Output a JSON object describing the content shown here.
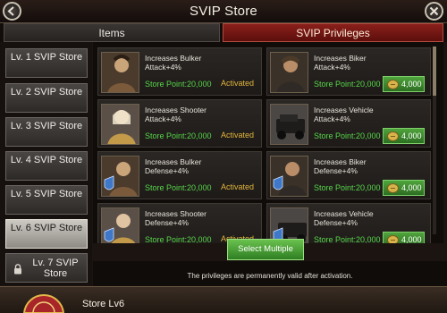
{
  "window": {
    "title": "SVIP Store"
  },
  "tabs": {
    "items": "Items",
    "privileges": "SVIP Privileges"
  },
  "sidebar": {
    "levels": [
      {
        "label": "Lv. 1 SVIP Store"
      },
      {
        "label": "Lv. 2 SVIP Store"
      },
      {
        "label": "Lv. 3 SVIP Store"
      },
      {
        "label": "Lv. 4 SVIP Store"
      },
      {
        "label": "Lv. 5 SVIP Store"
      },
      {
        "label": "Lv. 6 SVIP Store",
        "active": true
      },
      {
        "label": "Lv. 7 SVIP Store",
        "locked": true
      }
    ]
  },
  "privileges": [
    {
      "title": "Increases Bulker Attack+4%",
      "points": "Store Point:20,000",
      "status": "Activated"
    },
    {
      "title": "Increases Biker Attack+4%",
      "points": "Store Point:20,000",
      "price": "4,000"
    },
    {
      "title": "Increases Shooter Attack+4%",
      "points": "Store Point:20,000",
      "status": "Activated"
    },
    {
      "title": "Increases Vehicle Attack+4%",
      "points": "Store Point:20,000",
      "price": "4,000"
    },
    {
      "title": "Increases Bulker Defense+4%",
      "points": "Store Point:20,000",
      "status": "Activated"
    },
    {
      "title": "Increases Biker Defense+4%",
      "points": "Store Point:20,000",
      "price": "4,000"
    },
    {
      "title": "Increases Shooter Defense+4%",
      "points": "Store Point:20,000",
      "status": "Activated"
    },
    {
      "title": "Increases Vehicle Defense+4%",
      "points": "Store Point:20,000",
      "price": "4,000"
    }
  ],
  "actions": {
    "select_multiple": "Select Multiple"
  },
  "footer": {
    "note": "The privileges are permanently valid after activation."
  },
  "bottom": {
    "store_label": "Store  Lv6"
  },
  "icons": {
    "back": "back-arrow-icon",
    "close": "close-icon",
    "lock": "lock-icon",
    "coin": "coin-icon"
  },
  "colors": {
    "accent_red": "#8a1f1a",
    "points_green": "#58d64a",
    "activated_gold": "#e3b63c",
    "button_green": "#3f8f2f"
  }
}
